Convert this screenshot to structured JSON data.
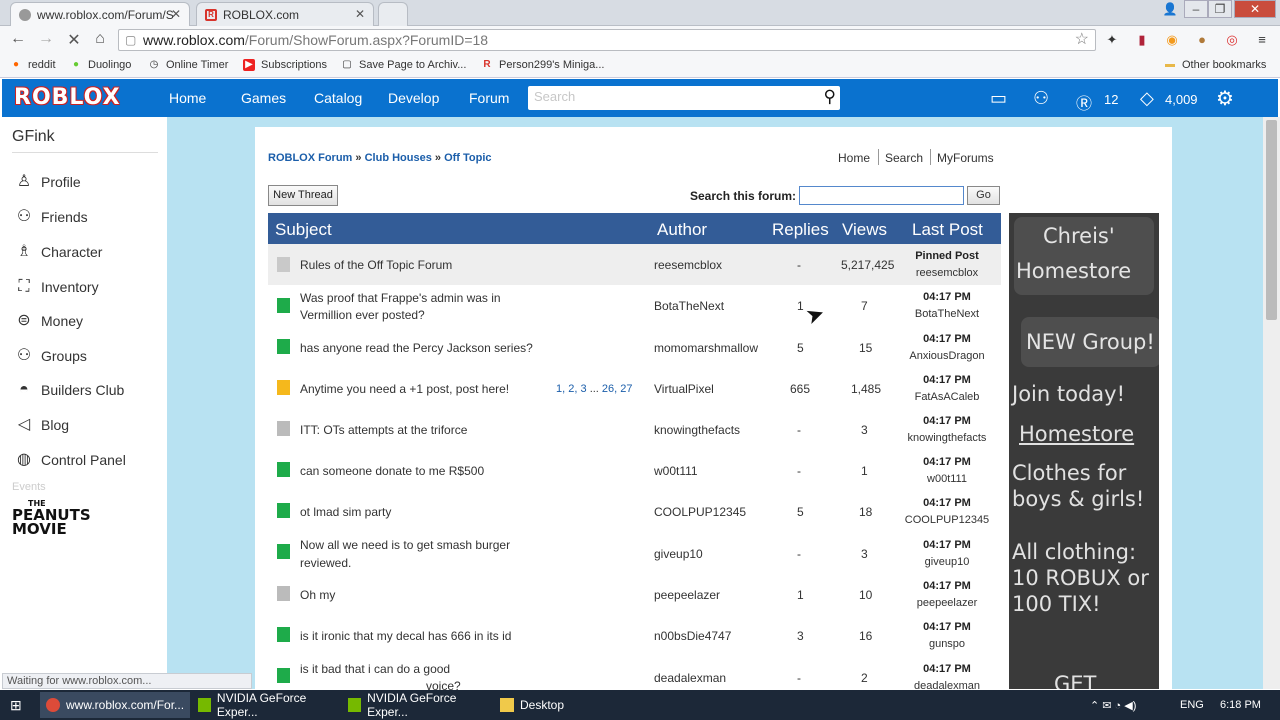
{
  "browser": {
    "tabs": [
      {
        "title": "www.roblox.com/Forum/S"
      },
      {
        "title": "ROBLOX.com"
      }
    ],
    "url_domain": "www.roblox.com",
    "url_path": "/Forum/ShowForum.aspx?ForumID=18",
    "bookmarks": [
      "reddit",
      "Duolingo",
      "Online Timer",
      "Subscriptions",
      "Save Page to Archiv...",
      "Person299's Miniga..."
    ],
    "other_bookmarks": "Other bookmarks",
    "status": "Waiting for www.roblox.com..."
  },
  "header": {
    "logo": "ROBLOX",
    "nav": [
      "Home",
      "Games",
      "Catalog",
      "Develop",
      "Forum"
    ],
    "search_placeholder": "Search",
    "robux": "12",
    "tix": "4,009"
  },
  "sidebar": {
    "username": "GFink",
    "items": [
      {
        "label": "Profile",
        "icon": "person-icon"
      },
      {
        "label": "Friends",
        "icon": "friends-icon"
      },
      {
        "label": "Character",
        "icon": "character-icon"
      },
      {
        "label": "Inventory",
        "icon": "backpack-icon"
      },
      {
        "label": "Money",
        "icon": "money-icon"
      },
      {
        "label": "Groups",
        "icon": "groups-icon"
      },
      {
        "label": "Builders Club",
        "icon": "hard-hat-icon"
      },
      {
        "label": "Blog",
        "icon": "megaphone-icon"
      },
      {
        "label": "Control Panel",
        "icon": "control-panel-icon"
      }
    ],
    "events_label": "Events",
    "event_logo": "THE PEANUTS MOVIE"
  },
  "forum": {
    "breadcrumb": [
      "ROBLOX Forum",
      "Club Houses",
      "Off Topic"
    ],
    "breadcrumb_sep": "»",
    "top_links": [
      "Home",
      "Search",
      "MyForums"
    ],
    "new_thread": "New Thread",
    "search_label": "Search this forum:",
    "go": "Go",
    "columns": [
      "Subject",
      "Author",
      "Replies",
      "Views",
      "Last Post"
    ],
    "threads": [
      {
        "subject": "Rules of the Off Topic Forum",
        "author": "reesemcblox",
        "replies": "-",
        "views": "5,217,425",
        "last_time": "Pinned Post",
        "last_user": "reesemcblox",
        "status": "pinned"
      },
      {
        "subject": "Was proof that Frappe's admin was in",
        "subject2": "Vermillion ever posted?",
        "author": "BotaTheNext",
        "replies": "1",
        "views": "7",
        "last_time": "04:17 PM",
        "last_user": "BotaTheNext",
        "status": "new"
      },
      {
        "subject": "has anyone read the Percy Jackson series?",
        "author": "momomarshmallow",
        "replies": "5",
        "views": "15",
        "last_time": "04:17 PM",
        "last_user": "AnxiousDragon",
        "status": "new"
      },
      {
        "subject": "Anytime you need a +1 post, post here!",
        "pages": [
          "1",
          "2",
          "3",
          "...",
          "26",
          "27"
        ],
        "author": "VirtualPixel",
        "replies": "665",
        "views": "1,485",
        "last_time": "04:17 PM",
        "last_user": "FatAsACaleb",
        "status": "hot"
      },
      {
        "subject": "ITT: OTs attempts at the triforce",
        "author": "knowingthefacts",
        "replies": "-",
        "views": "3",
        "last_time": "04:17 PM",
        "last_user": "knowingthefacts",
        "status": "read"
      },
      {
        "subject": "can someone donate to me R$500",
        "author": "w00t111",
        "replies": "-",
        "views": "1",
        "last_time": "04:17 PM",
        "last_user": "w00t111",
        "status": "new"
      },
      {
        "subject": "ot lmad sim party",
        "author": "COOLPUP12345",
        "replies": "5",
        "views": "18",
        "last_time": "04:17 PM",
        "last_user": "COOLPUP12345",
        "status": "new"
      },
      {
        "subject": "Now all we need is to get smash burger",
        "subject2": "reviewed.",
        "author": "giveup10",
        "replies": "-",
        "views": "3",
        "last_time": "04:17 PM",
        "last_user": "giveup10",
        "status": "new"
      },
      {
        "subject": "Oh my",
        "author": "peepeelazer",
        "replies": "1",
        "views": "10",
        "last_time": "04:17 PM",
        "last_user": "peepeelazer",
        "status": "read"
      },
      {
        "subject": "is it ironic that my decal has 666 in its id",
        "author": "n00bsDie4747",
        "replies": "3",
        "views": "16",
        "last_time": "04:17 PM",
        "last_user": "gunspo",
        "status": "new"
      },
      {
        "subject": "is it bad that i can do a good",
        "subject2": "voice?",
        "author": "deadalexman",
        "replies": "-",
        "views": "2",
        "last_time": "04:17 PM",
        "last_user": "deadalexman",
        "status": "new"
      }
    ]
  },
  "ad": {
    "lines": [
      "Chreis'",
      "Homestore",
      "NEW Group!",
      "Join today!",
      "Homestore",
      "Clothes for",
      "boys & girls!",
      "All clothing:",
      "10 ROBUX or",
      "100 TIX!",
      "GET"
    ]
  },
  "taskbar": {
    "items": [
      "www.roblox.com/For...",
      "NVIDIA GeForce Exper...",
      "NVIDIA GeForce Exper...",
      "Desktop"
    ],
    "lang": "ENG",
    "time": "6:18 PM"
  },
  "colors": {
    "roblox_blue": "#0a72cf",
    "table_header": "#335c97",
    "new_icon": "#1eab4a",
    "hot_icon": "#f5b81c",
    "page_bg": "#b8e2f2"
  }
}
